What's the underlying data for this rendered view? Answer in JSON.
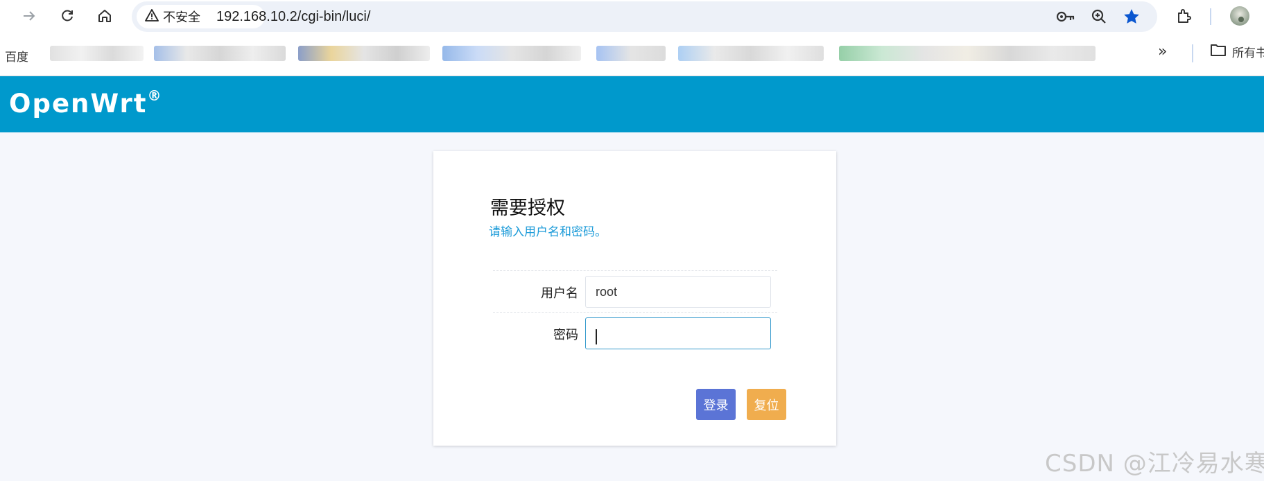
{
  "browser": {
    "security_label": "不安全",
    "url": "192.168.10.2/cgi-bin/luci/",
    "icons": [
      "forward-icon",
      "reload-icon",
      "home-icon",
      "warning-icon",
      "key-icon",
      "zoom-icon",
      "star-icon",
      "extensions-icon",
      "profile-avatar"
    ]
  },
  "bookmarks": {
    "first": "百度",
    "overflow": "»",
    "all_bookmarks": "所有书签"
  },
  "header": {
    "brand": "OpenWrt",
    "registered": "®",
    "color": "#0099cc"
  },
  "login": {
    "title": "需要授权",
    "subtitle": "请输入用户名和密码。",
    "username_label": "用户名",
    "username_value": "root",
    "password_label": "密码",
    "password_value": "",
    "login_button": "登录",
    "reset_button": "复位",
    "colors": {
      "login": "#5b74d6",
      "reset": "#f0ad4e",
      "subtitle": "#1a9ad8"
    }
  },
  "watermark": "CSDN @江冷易水寒"
}
